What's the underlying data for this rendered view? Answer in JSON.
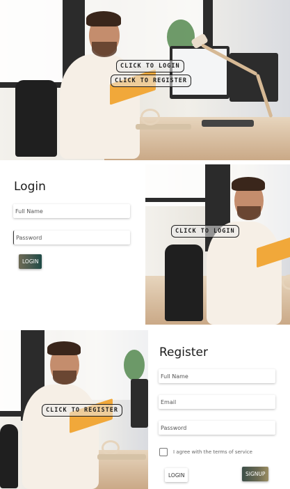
{
  "hero": {
    "login_link": "CLICK TO LOGIN",
    "register_link": "CLICK TO REGISTER"
  },
  "login": {
    "title": "Login",
    "full_name_placeholder": "Full Name",
    "password_placeholder": "Password",
    "login_button": "LOGIN",
    "photo_link": "CLICK TO LOGIN"
  },
  "register": {
    "title": "Register",
    "full_name_placeholder": "Full Name",
    "email_placeholder": "Email",
    "password_placeholder": "Password",
    "terms_label": "I agree with the terms of service",
    "terms_checked": false,
    "login_button": "LOGIN",
    "signup_button": "SIGNUP",
    "photo_link": "CLICK TO REGISTER"
  },
  "colors": {
    "accent_gradient_start": "#6d6a55",
    "accent_gradient_end": "#1e4b46",
    "link_border": "#1e1e1e"
  }
}
